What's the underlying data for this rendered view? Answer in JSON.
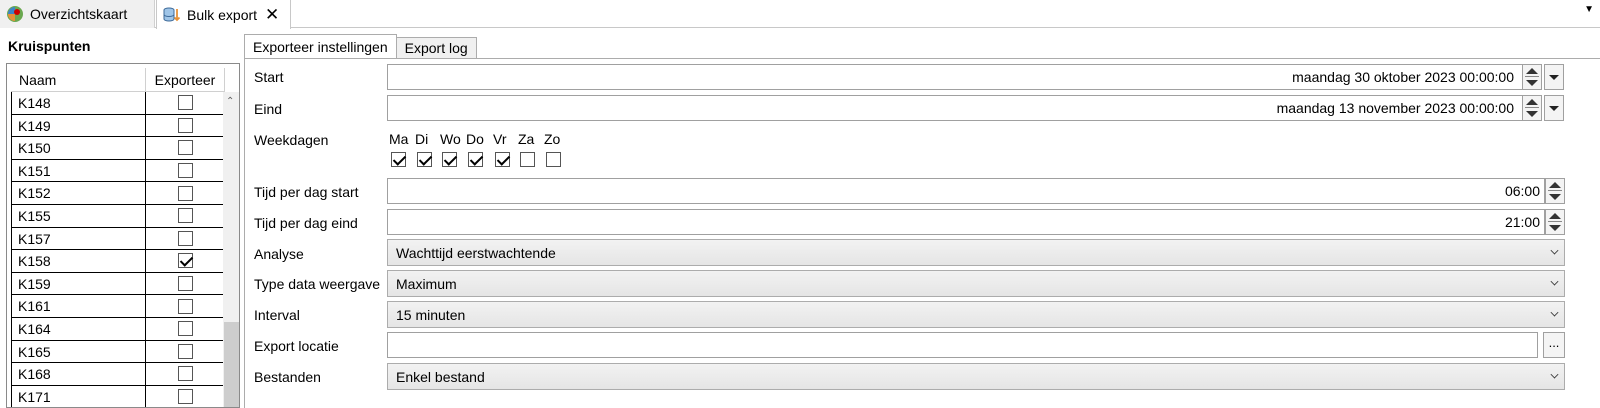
{
  "tabs": [
    {
      "label": "Overzichtskaart",
      "icon": "map-pin-icon"
    },
    {
      "label": "Bulk export",
      "icon": "database-export-icon",
      "close": "✕"
    }
  ],
  "left": {
    "title": "Kruispunten",
    "columns": [
      "Naam",
      "Exporteer"
    ],
    "rows": [
      {
        "name": "K148",
        "checked": false
      },
      {
        "name": "K149",
        "checked": false
      },
      {
        "name": "K150",
        "checked": false
      },
      {
        "name": "K151",
        "checked": false
      },
      {
        "name": "K152",
        "checked": false
      },
      {
        "name": "K155",
        "checked": false
      },
      {
        "name": "K157",
        "checked": false
      },
      {
        "name": "K158",
        "checked": true
      },
      {
        "name": "K159",
        "checked": false
      },
      {
        "name": "K161",
        "checked": false
      },
      {
        "name": "K164",
        "checked": false
      },
      {
        "name": "K165",
        "checked": false
      },
      {
        "name": "K168",
        "checked": false
      },
      {
        "name": "K171",
        "checked": false
      }
    ]
  },
  "subtabs": {
    "settings": "Exporteer instellingen",
    "log": "Export log"
  },
  "form": {
    "start_label": "Start",
    "start_value": "maandag 30 oktober 2023 00:00:00",
    "end_label": "Eind",
    "end_value": "maandag 13 november 2023 00:00:00",
    "weekdays_label": "Weekdagen",
    "weekdays": [
      {
        "label": "Ma",
        "checked": true
      },
      {
        "label": "Di",
        "checked": true
      },
      {
        "label": "Wo",
        "checked": true
      },
      {
        "label": "Do",
        "checked": true
      },
      {
        "label": "Vr",
        "checked": true
      },
      {
        "label": "Za",
        "checked": false
      },
      {
        "label": "Zo",
        "checked": false
      }
    ],
    "time_start_label": "Tijd per dag start",
    "time_start_value": "06:00",
    "time_end_label": "Tijd per dag eind",
    "time_end_value": "21:00",
    "analysis_label": "Analyse",
    "analysis_value": "Wachttijd eerstwachtende",
    "type_label": "Type data weergave",
    "type_value": "Maximum",
    "interval_label": "Interval",
    "interval_value": "15 minuten",
    "location_label": "Export locatie",
    "location_value": "",
    "browse_label": "...",
    "files_label": "Bestanden",
    "files_value": "Enkel bestand"
  }
}
